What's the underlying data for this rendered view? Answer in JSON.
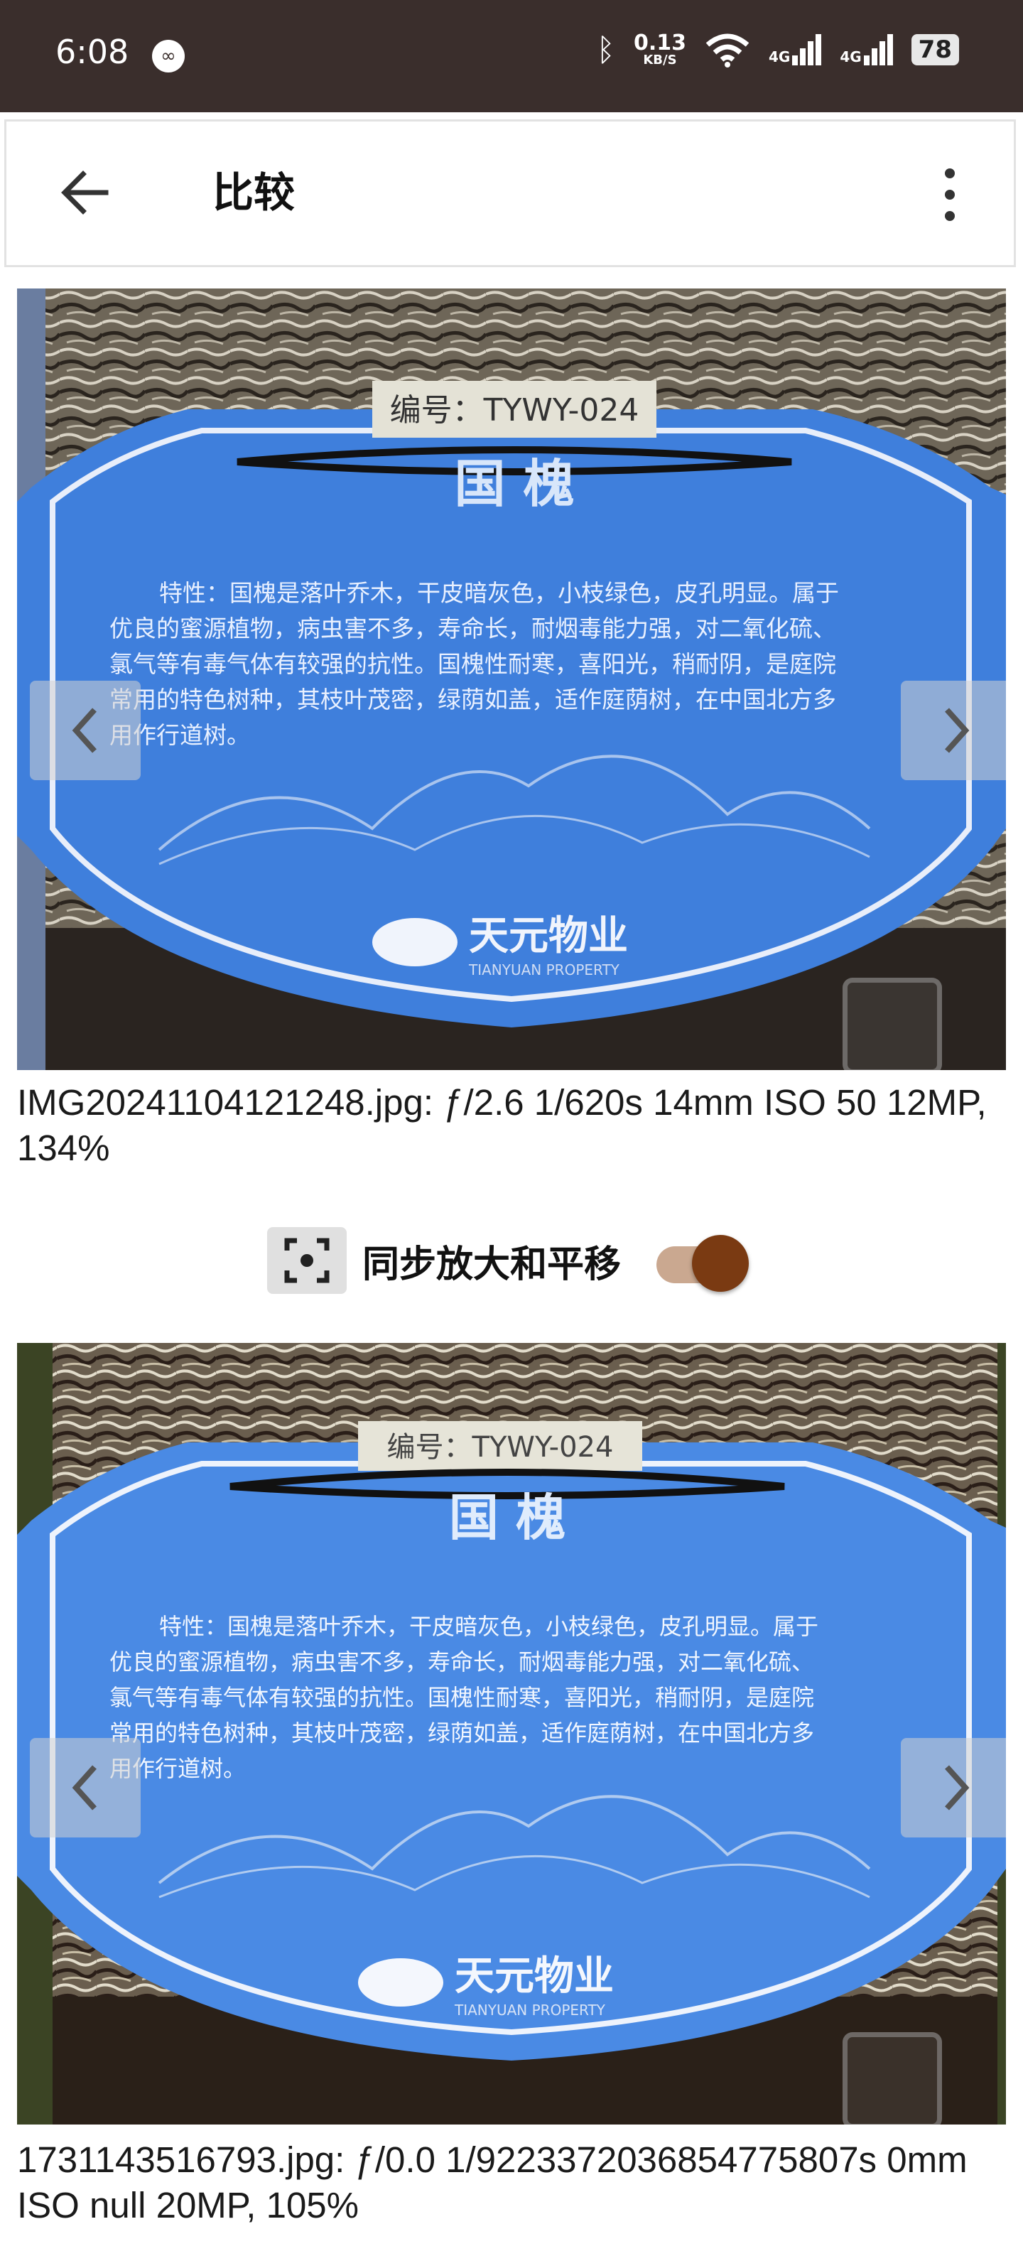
{
  "status_bar": {
    "time": "6:08",
    "net_speed_value": "0.13",
    "net_speed_unit": "KB/S",
    "signal1": "4G",
    "signal2": "4G",
    "battery": "78"
  },
  "app_bar": {
    "title": "比较"
  },
  "viewer_top": {
    "sign_number": "编号：TYWY-024",
    "sign_title": "国  槐",
    "sign_text": [
      "特性：国槐是落叶乔木，干皮暗灰色，小枝绿色，皮孔明显。属于",
      "优良的蜜源植物，病虫害不多，寿命长，耐烟毒能力强，对二氧化硫、",
      "氯气等有毒气体有较强的抗性。国槐性耐寒，喜阳光，稍耐阴，是庭院",
      "常用的特色树种，其枝叶茂密，绿荫如盖，适作庭荫树，在中国北方多",
      "用作行道树。"
    ],
    "brand_cn": "天元物业",
    "brand_en": "TIANYUAN PROPERTY",
    "caption": "IMG20241104121248.jpg: ƒ/2.6 1/620s 14mm ISO 50 12MP, 134%"
  },
  "sync": {
    "label": "同步放大和平移",
    "enabled": true
  },
  "viewer_bottom": {
    "sign_number": "编号：TYWY-024",
    "sign_title": "国  槐",
    "sign_text": [
      "特性：国槐是落叶乔木，干皮暗灰色，小枝绿色，皮孔明显。属于",
      "优良的蜜源植物，病虫害不多，寿命长，耐烟毒能力强，对二氧化硫、",
      "氯气等有毒气体有较强的抗性。国槐性耐寒，喜阳光，稍耐阴，是庭院",
      "常用的特色树种，其枝叶茂密，绿荫如盖，适作庭荫树，在中国北方多",
      "用作行道树。"
    ],
    "brand_cn": "天元物业",
    "brand_en": "TIANYUAN PROPERTY",
    "caption": "1731143516793.jpg: ƒ/0.0 1/9223372036854775807s 0mm ISO null 20MP, 105%"
  },
  "colors": {
    "status_bar_bg": "#3a2e2c",
    "accent_thumb": "#7a3a12",
    "sign_blue": "#3f7fdc"
  }
}
